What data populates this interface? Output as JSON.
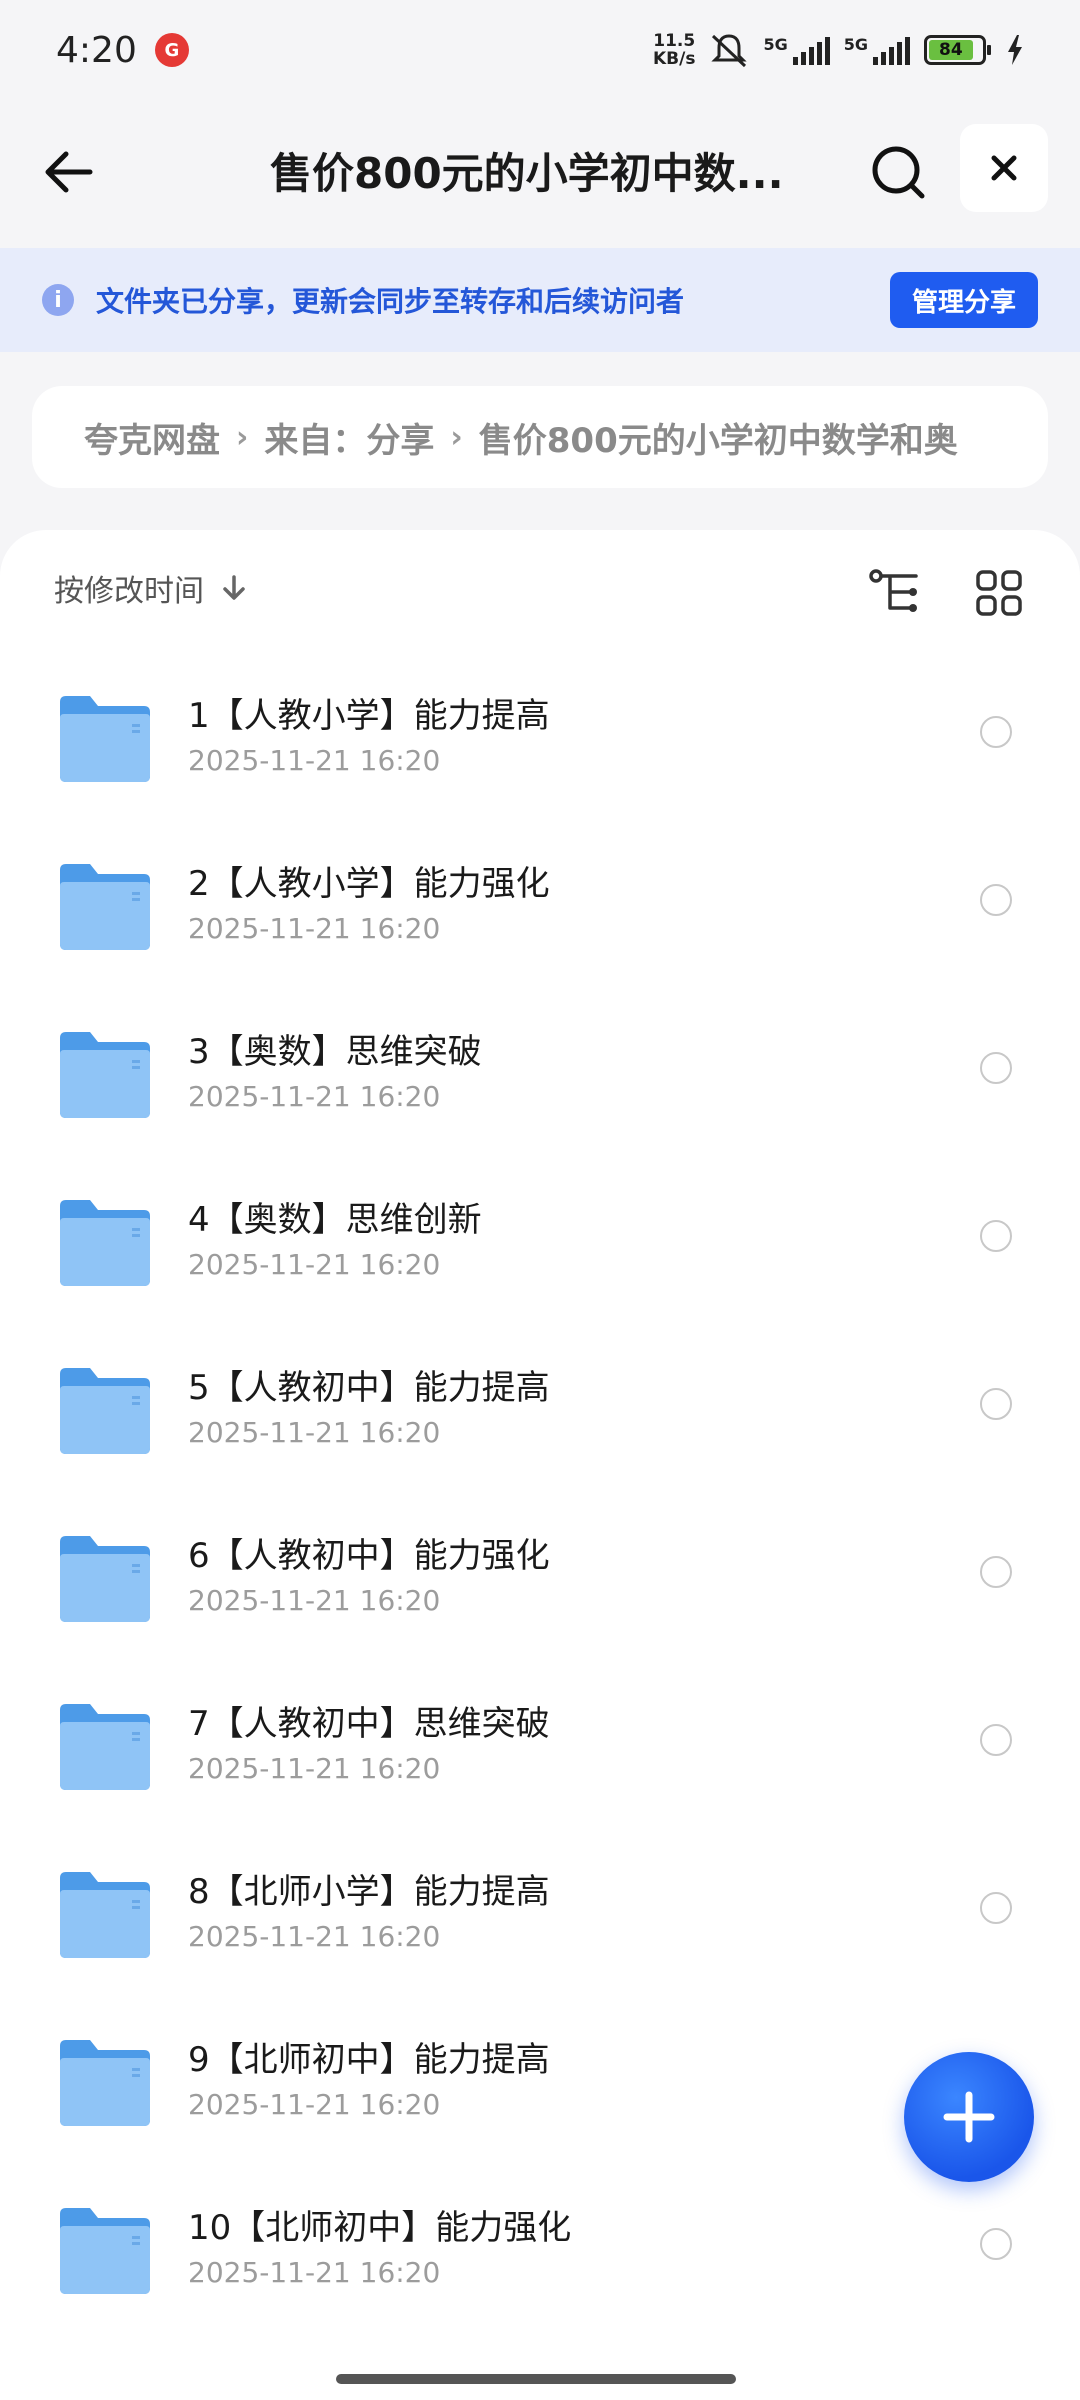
{
  "status_bar": {
    "time": "4:20",
    "app_badge": "G",
    "net_speed_top": "11.5",
    "net_speed_bottom": "KB/s",
    "sim1": "5G",
    "sim2": "5G",
    "battery": "84"
  },
  "header": {
    "title": "售价800元的小学初中数..."
  },
  "banner": {
    "text": "文件夹已分享，更新会同步至转存和后续访问者",
    "manage_label": "管理分享"
  },
  "breadcrumb": {
    "items": [
      "夸克网盘",
      "来自：分享",
      "售价800元的小学初中数学和奥"
    ]
  },
  "sort": {
    "label": "按修改时间"
  },
  "files": [
    {
      "name": "1【人教小学】能力提高",
      "date": "2025-11-21 16:20"
    },
    {
      "name": "2【人教小学】能力强化",
      "date": "2025-11-21 16:20"
    },
    {
      "name": "3【奥数】思维突破",
      "date": "2025-11-21 16:20"
    },
    {
      "name": "4【奥数】思维创新",
      "date": "2025-11-21 16:20"
    },
    {
      "name": "5【人教初中】能力提高",
      "date": "2025-11-21 16:20"
    },
    {
      "name": "6【人教初中】能力强化",
      "date": "2025-11-21 16:20"
    },
    {
      "name": "7【人教初中】思维突破",
      "date": "2025-11-21 16:20"
    },
    {
      "name": "8【北师小学】能力提高",
      "date": "2025-11-21 16:20"
    },
    {
      "name": "9【北师初中】能力提高",
      "date": "2025-11-21 16:20"
    },
    {
      "name": "10【北师初中】能力强化",
      "date": "2025-11-21 16:20"
    }
  ],
  "colors": {
    "accent": "#1f5cf0",
    "banner_bg": "#e7ecfb",
    "folder": "#64adf2"
  }
}
